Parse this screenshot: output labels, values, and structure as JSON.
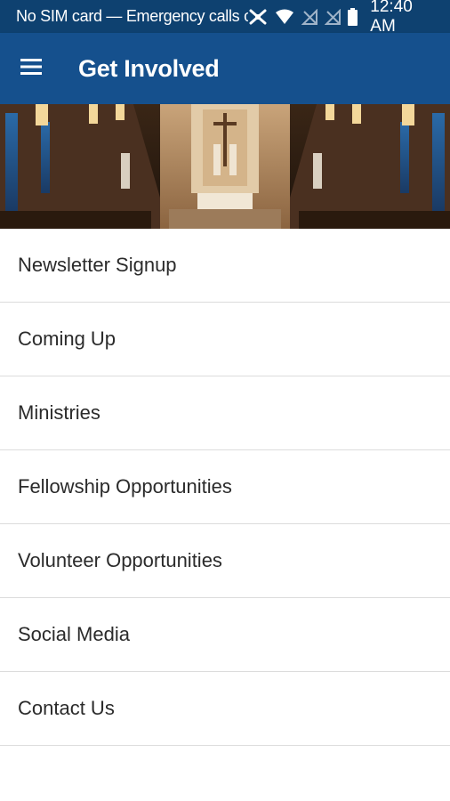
{
  "status_bar": {
    "carrier_text": "No SIM card — Emergency calls only",
    "time": "12:40 AM",
    "icons": [
      "no-network-icon",
      "wifi-icon",
      "no-sim-icon",
      "no-sim-icon",
      "battery-icon"
    ]
  },
  "app_bar": {
    "menu_icon": "hamburger-menu-icon",
    "title": "Get Involved"
  },
  "hero": {
    "image": "church-altar-interior-photo"
  },
  "menu_items": [
    {
      "label": "Newsletter Signup"
    },
    {
      "label": "Coming Up"
    },
    {
      "label": "Ministries"
    },
    {
      "label": "Fellowship Opportunities"
    },
    {
      "label": "Volunteer Opportunities"
    },
    {
      "label": "Social Media"
    },
    {
      "label": "Contact Us"
    }
  ],
  "colors": {
    "status_bar": "#0e4170",
    "app_bar": "#15508d",
    "divider": "#dcdcdc",
    "text": "#2b2b2b"
  }
}
